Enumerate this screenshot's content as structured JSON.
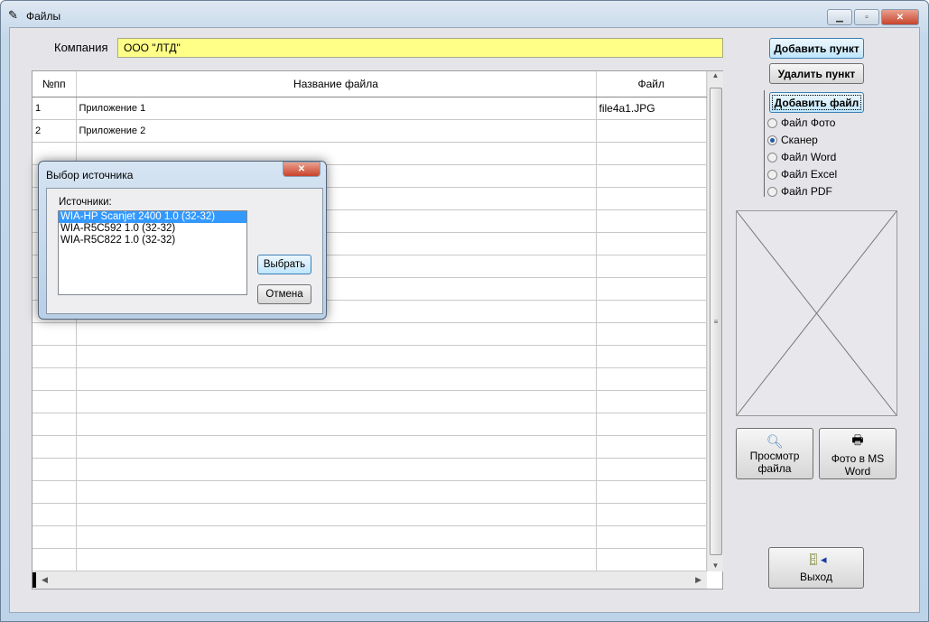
{
  "window": {
    "title": "Файлы",
    "minimize": "–",
    "maximize": "□",
    "close": "✕"
  },
  "company": {
    "label": "Компания",
    "value": "ООО \"ЛТД\""
  },
  "table": {
    "headers": [
      "№пп",
      "Название файла",
      "Файл"
    ],
    "rows": [
      [
        "1",
        "Приложение 1",
        "file4a1.JPG"
      ],
      [
        "2",
        "Приложение 2",
        ""
      ]
    ],
    "empty_rows": 19
  },
  "buttons": {
    "add_item": "Добавить пункт",
    "delete_item": "Удалить пункт",
    "add_file": "Добавить файл",
    "view_file": "Просмотр файла",
    "photo_word": "Фото в MS Word",
    "exit": "Выход"
  },
  "file_types": [
    {
      "label": "Файл Фото",
      "checked": false
    },
    {
      "label": "Сканер",
      "checked": true
    },
    {
      "label": "Файл Word",
      "checked": false
    },
    {
      "label": "Файл Excel",
      "checked": false
    },
    {
      "label": "Файл PDF",
      "checked": false
    }
  ],
  "dialog": {
    "title": "Выбор источника",
    "sources_label": "Источники:",
    "sources": [
      "WIA-HP Scanjet 2400 1.0 (32-32)",
      "WIA-R5C592 1.0 (32-32)",
      "WIA-R5C822 1.0 (32-32)"
    ],
    "selected": 0,
    "select": "Выбрать",
    "cancel": "Отмена"
  }
}
